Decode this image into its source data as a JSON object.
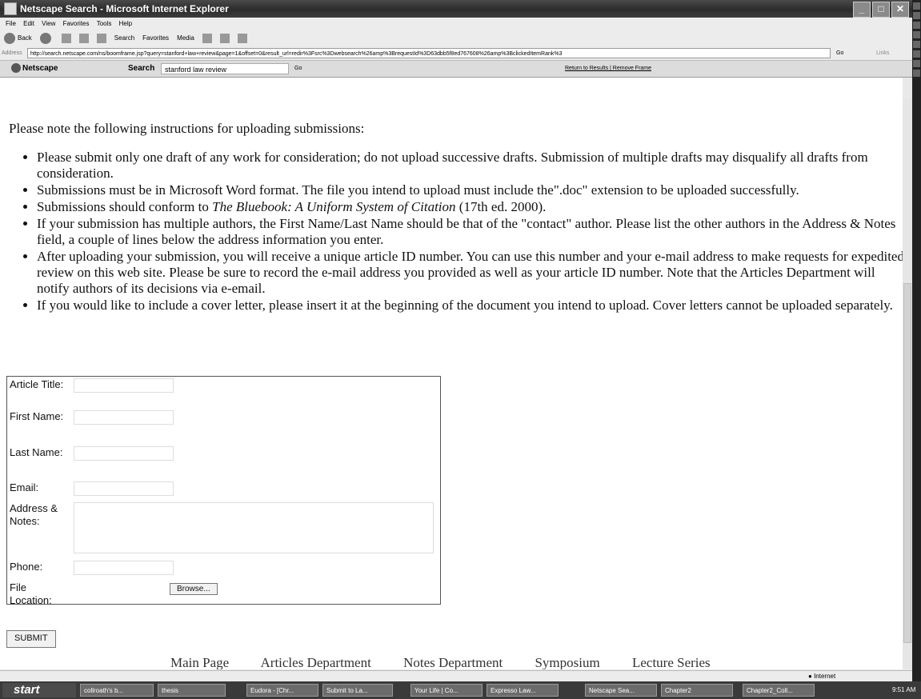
{
  "window": {
    "title": "Netscape Search - Microsoft Internet Explorer"
  },
  "menu": [
    "File",
    "Edit",
    "View",
    "Favorites",
    "Tools",
    "Help"
  ],
  "toolbar": {
    "back": "Back",
    "search": "Search",
    "favorites": "Favorites",
    "media": "Media"
  },
  "address": {
    "label": "Address",
    "url": "http://search.netscape.com/ns/boomframe.jsp?query=stanford+law+review&page=1&offset=0&result_url=redir%3Fsrc%3Dwebsearch%26amp%3BrequestId%3D63dbb5f8ed767608%26amp%3BclickedItemRank%3",
    "go": "Go",
    "links": "Links"
  },
  "netscape_bar": {
    "logo": "Netscape",
    "search_label": "Search",
    "search_value": "stanford law review",
    "go": "Go",
    "links": "Return to Results | Remove Frame"
  },
  "content": {
    "intro": "Please note the following instructions for uploading submissions:",
    "bullets": [
      "Please submit only one draft of any work for consideration; do not upload successive drafts. Submission of multiple drafts may disqualify all drafts from consideration.",
      "Submissions must be in Microsoft Word format. The file you intend to upload must include the\".doc\" extension to be uploaded successfully.",
      "If your submission has multiple authors, the First Name/Last Name should be that of the \"contact\" author. Please list the other authors in the Address & Notes field, a couple of lines below the address information you enter.",
      "After uploading your submission, you will receive a unique article ID number. You can use this number and your e-mail address to make requests for expedited review on this web site. Please be sure to record the e-mail address you provided as well as your article ID number. Note that the Articles Department will notify authors of its decisions via e-email.",
      "If you would like to include a cover letter, please insert it at the beginning of the document you intend to upload. Cover letters cannot be uploaded separately."
    ],
    "bluebook": {
      "prefix": "Submissions should conform to ",
      "title": "The Bluebook: A Uniform System of Citation",
      "suffix": " (17th ed. 2000)."
    }
  },
  "form": {
    "article_title": "Article Title:",
    "first_name": "First Name:",
    "last_name": "Last Name:",
    "email": "Email:",
    "address_notes": "Address & Notes:",
    "phone": "Phone:",
    "file_location": "File Location:",
    "browse": "Browse...",
    "submit": "SUBMIT"
  },
  "footer_links": [
    "Main Page",
    "Articles Department",
    "Notes Department",
    "Symposium",
    "Lecture Series"
  ],
  "status": {
    "zone": "Internet"
  },
  "taskbar": {
    "start": "start",
    "tasks": [
      "collroath's b...",
      "thesis",
      "Eudora - [Chr...",
      "Submit to La...",
      "Your Life | Co...",
      "Expresso Law...",
      "Netscape Sea...",
      "Chapter2",
      "Chapter2_Coll..."
    ],
    "clock": "9:51 AM"
  }
}
